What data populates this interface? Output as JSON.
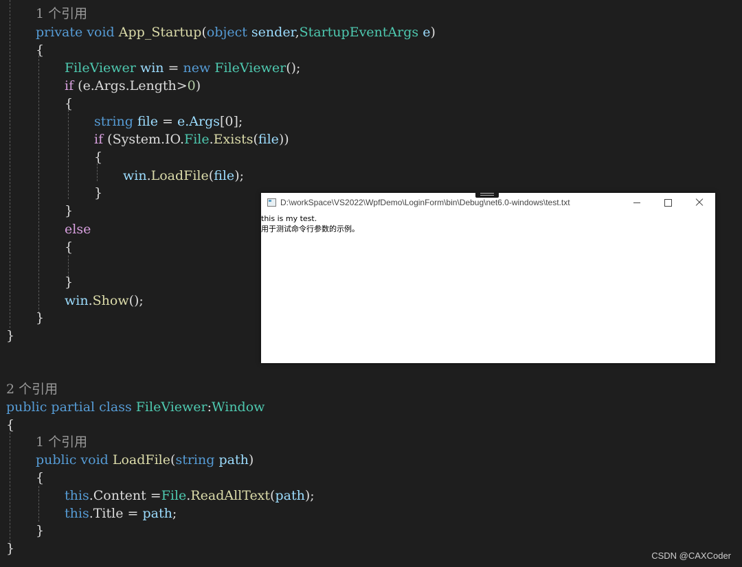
{
  "code": {
    "ref1": "1 个引用",
    "ref2": "2 个引用",
    "ref3": "1 个引用",
    "kw_private": "private",
    "kw_void": "void",
    "mth_app_startup": "App_Startup",
    "p_open": "(",
    "kw_object": "object",
    "par_sender": "sender",
    "comma": ",",
    "typ_startup_args": "StartupEventArgs",
    "par_e": "e",
    "p_close": ")",
    "brace_open": "{",
    "brace_close": "}",
    "typ_fileviewer": "FileViewer",
    "var_win": "win",
    "op_assign": " = ",
    "kw_new": "new",
    "call_empty": "();",
    "ctl_if": "if",
    "cond_open": " (",
    "e_args_length": "e.Args.Length",
    "op_gt": ">",
    "num_zero": "0",
    "kw_string": "string",
    "var_file": "file",
    "e_args": "e.Args",
    "idx_zero": "[0];",
    "system_io": "System.IO.",
    "typ_file": "File",
    "dot": ".",
    "mth_exists": "Exists",
    "close2": "))",
    "mth_loadfile": "LoadFile",
    "semi_close": ");",
    "ctl_else": "else",
    "mth_show": "Show",
    "kw_public": "public",
    "kw_partial": "partial",
    "kw_class": "class",
    "colon": ":",
    "typ_window": "Window",
    "par_path": "path",
    "kw_this": "this",
    "prop_content": "Content",
    "op_assign_tight": " =",
    "mth_readalltext": "ReadAllText",
    "prop_title": "Title",
    "semi": ";"
  },
  "window": {
    "title": "D:\\workSpace\\VS2022\\WpfDemo\\LoginForm\\bin\\Debug\\net6.0-windows\\test.txt",
    "content_lines": [
      "this is my test.",
      "用于测试命令行参数的示例。"
    ],
    "minimize_glyph": "minimize-icon",
    "maximize_glyph": "maximize-icon",
    "close_glyph": "close-icon"
  },
  "watermark": "CSDN @CAXCoder",
  "colors": {
    "background": "#1e1e1e",
    "keyword": "#569cd6",
    "control": "#d8a0df",
    "type": "#4ec9b0",
    "method": "#dcdcaa",
    "parameter": "#9cdcfe",
    "number": "#b5cea8"
  }
}
